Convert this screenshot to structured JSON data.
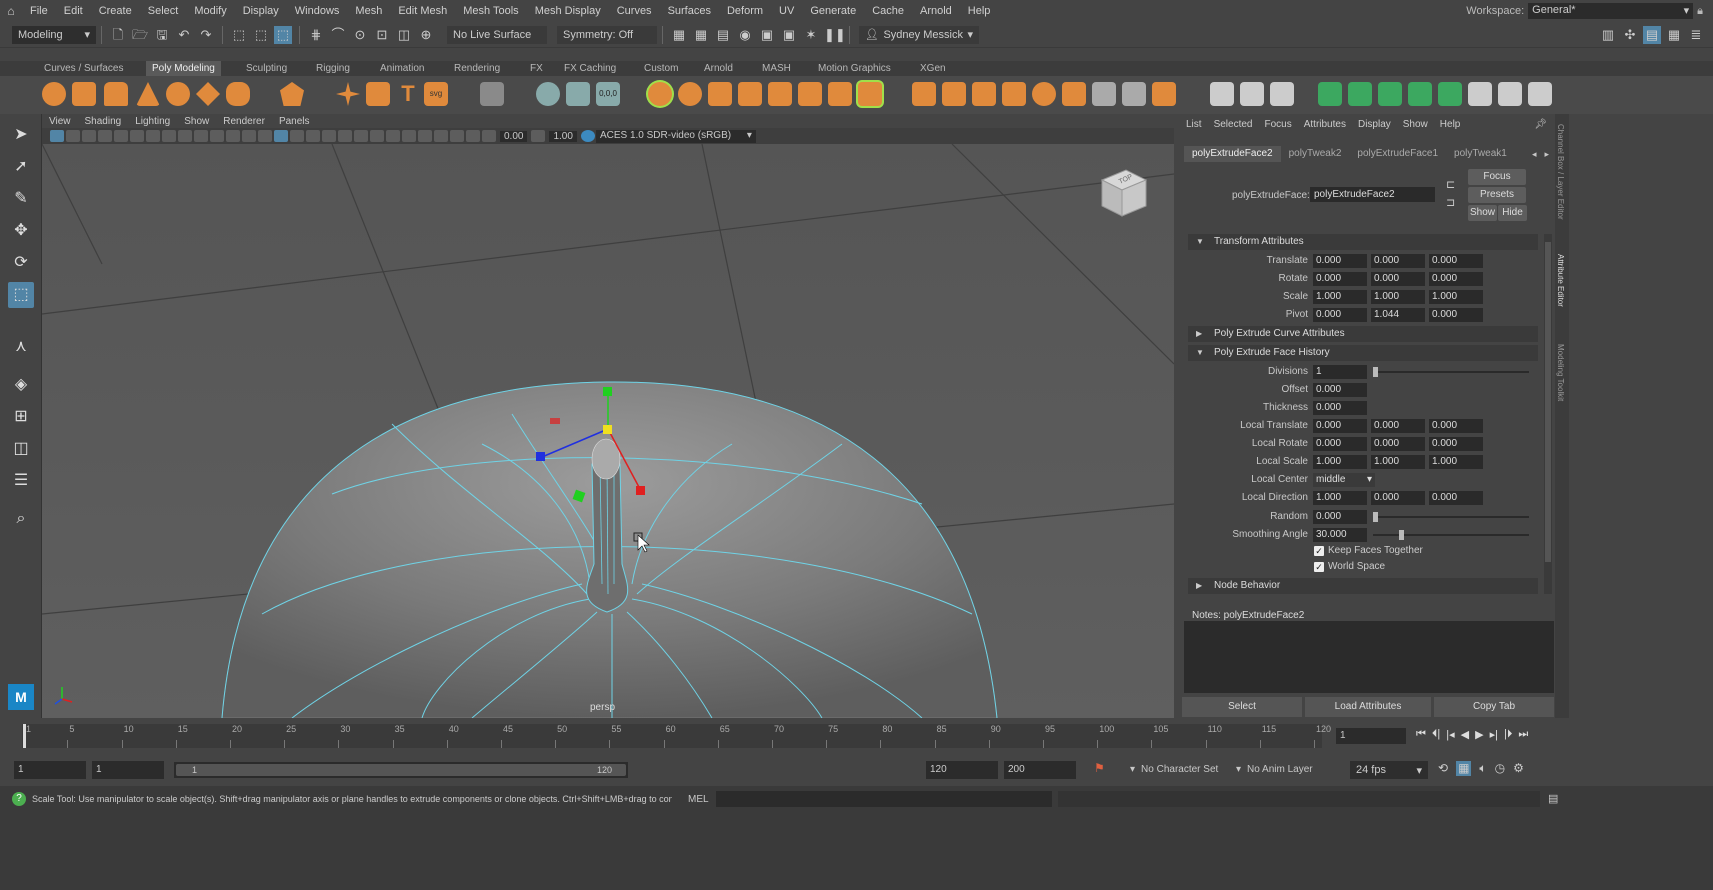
{
  "menubar": {
    "items": [
      "File",
      "Edit",
      "Create",
      "Select",
      "Modify",
      "Display",
      "Windows",
      "Mesh",
      "Edit Mesh",
      "Mesh Tools",
      "Mesh Display",
      "Curves",
      "Surfaces",
      "Deform",
      "UV",
      "Generate",
      "Cache",
      "Arnold",
      "Help"
    ],
    "workspace_label": "Workspace:",
    "workspace_value": "General*"
  },
  "statusline": {
    "mode": "Modeling",
    "live_surface": "No Live Surface",
    "symmetry": "Symmetry: Off",
    "user": "Sydney Messick"
  },
  "shelf": {
    "tabs": [
      "Curves / Surfaces",
      "Poly Modeling",
      "Sculpting",
      "Rigging",
      "Animation",
      "Rendering",
      "FX",
      "FX Caching",
      "Custom",
      "Arnold",
      "MASH",
      "Motion Graphics",
      "XGen"
    ],
    "active_tab": "Poly Modeling"
  },
  "viewport": {
    "menus": [
      "View",
      "Shading",
      "Lighting",
      "Show",
      "Renderer",
      "Panels"
    ],
    "exposure": "0.00",
    "gamma": "1.00",
    "colorspace": "ACES 1.0 SDR-video (sRGB)",
    "camera_label": "persp",
    "viewcube_label": "TOP"
  },
  "attribute_editor": {
    "menus": [
      "List",
      "Selected",
      "Focus",
      "Attributes",
      "Display",
      "Show",
      "Help"
    ],
    "tabs": [
      "polyExtrudeFace2",
      "polyTweak2",
      "polyExtrudeFace1",
      "polyTweak1"
    ],
    "node_label": "polyExtrudeFace:",
    "node_name": "polyExtrudeFace2",
    "focus_btn": "Focus",
    "presets_btn": "Presets",
    "show_btn": "Show",
    "hide_btn": "Hide",
    "sections": {
      "transform": "Transform Attributes",
      "curve": "Poly Extrude Curve Attributes",
      "history": "Poly Extrude Face History",
      "node_behavior": "Node Behavior"
    },
    "transform": {
      "translate": {
        "label": "Translate",
        "x": "0.000",
        "y": "0.000",
        "z": "0.000"
      },
      "rotate": {
        "label": "Rotate",
        "x": "0.000",
        "y": "0.000",
        "z": "0.000"
      },
      "scale": {
        "label": "Scale",
        "x": "1.000",
        "y": "1.000",
        "z": "1.000"
      },
      "pivot": {
        "label": "Pivot",
        "x": "0.000",
        "y": "1.044",
        "z": "0.000"
      }
    },
    "history": {
      "divisions": {
        "label": "Divisions",
        "value": "1"
      },
      "offset": {
        "label": "Offset",
        "value": "0.000"
      },
      "thickness": {
        "label": "Thickness",
        "value": "0.000"
      },
      "local_translate": {
        "label": "Local Translate",
        "x": "0.000",
        "y": "0.000",
        "z": "0.000"
      },
      "local_rotate": {
        "label": "Local Rotate",
        "x": "0.000",
        "y": "0.000",
        "z": "0.000"
      },
      "local_scale": {
        "label": "Local Scale",
        "x": "1.000",
        "y": "1.000",
        "z": "1.000"
      },
      "local_center": {
        "label": "Local Center",
        "value": "middle"
      },
      "local_direction": {
        "label": "Local Direction",
        "x": "1.000",
        "y": "0.000",
        "z": "0.000"
      },
      "random": {
        "label": "Random",
        "value": "0.000"
      },
      "smoothing_angle": {
        "label": "Smoothing Angle",
        "value": "30.000"
      },
      "keep_faces_together": "Keep Faces Together",
      "world_space": "World Space"
    },
    "notes_label": "Notes:  polyExtrudeFace2",
    "bottom_buttons": [
      "Select",
      "Load Attributes",
      "Copy Tab"
    ]
  },
  "side_labels": [
    "Channel Box / Layer Editor",
    "Attribute Editor",
    "Modeling Toolkit"
  ],
  "timeslider": {
    "ticks": [
      "1",
      "5",
      "10",
      "15",
      "20",
      "25",
      "30",
      "35",
      "40",
      "45",
      "50",
      "55",
      "60",
      "65",
      "70",
      "75",
      "80",
      "85",
      "90",
      "95",
      "100",
      "105",
      "110",
      "115",
      "120"
    ],
    "current_frame": "1"
  },
  "rangeslider": {
    "start": "1",
    "anim_start": "1",
    "range_start": "1",
    "range_end": "120",
    "anim_end_field": "120",
    "end": "200",
    "character_set": "No Character Set",
    "anim_layer": "No Anim Layer",
    "fps": "24 fps"
  },
  "helpline": {
    "text": "Scale Tool: Use manipulator to scale object(s). Shift+drag manipulator axis or plane handles to extrude components or clone objects. Ctrl+Shift+LMB+drag to constrain scaling to",
    "mel_label": "MEL"
  },
  "colors": {
    "wire": "#6fd3e6",
    "active_tool": "#5285a6",
    "manip_x": "#e02020",
    "manip_y": "#20d020",
    "manip_z": "#2030e0",
    "manip_center": "#f0e020"
  }
}
